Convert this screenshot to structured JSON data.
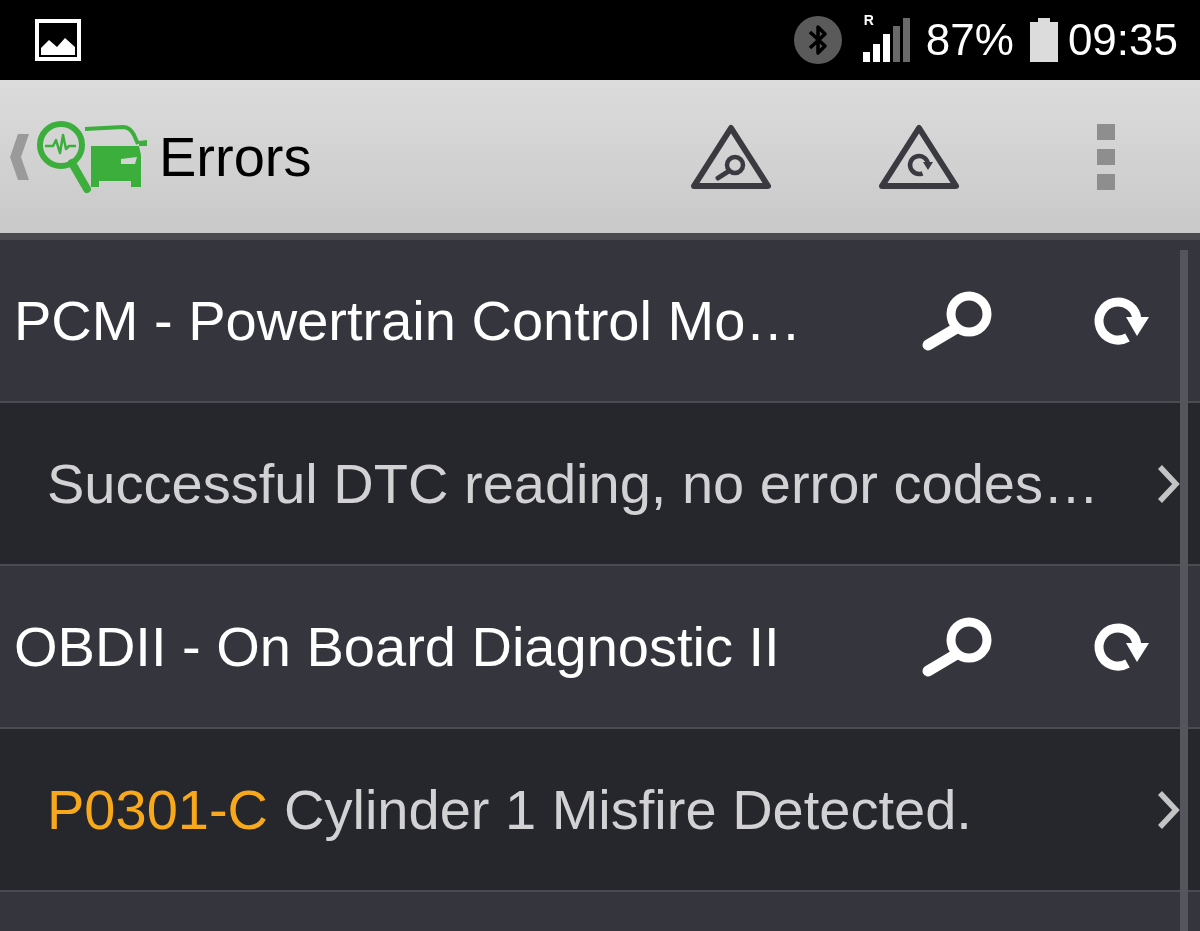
{
  "status_bar": {
    "roaming_indicator": "R",
    "battery": "87%",
    "time": "09:35"
  },
  "app_bar": {
    "title": "Errors"
  },
  "modules": [
    {
      "name": "PCM - Powertrain Control Mo…",
      "results": [
        {
          "kind": "message",
          "text": "Successful DTC reading, no error codes…"
        }
      ]
    },
    {
      "name": "OBDII - On Board Diagnostic II",
      "results": [
        {
          "kind": "code",
          "code": "P0301-C",
          "description": "Cylinder 1 Misfire Detected."
        }
      ]
    }
  ]
}
